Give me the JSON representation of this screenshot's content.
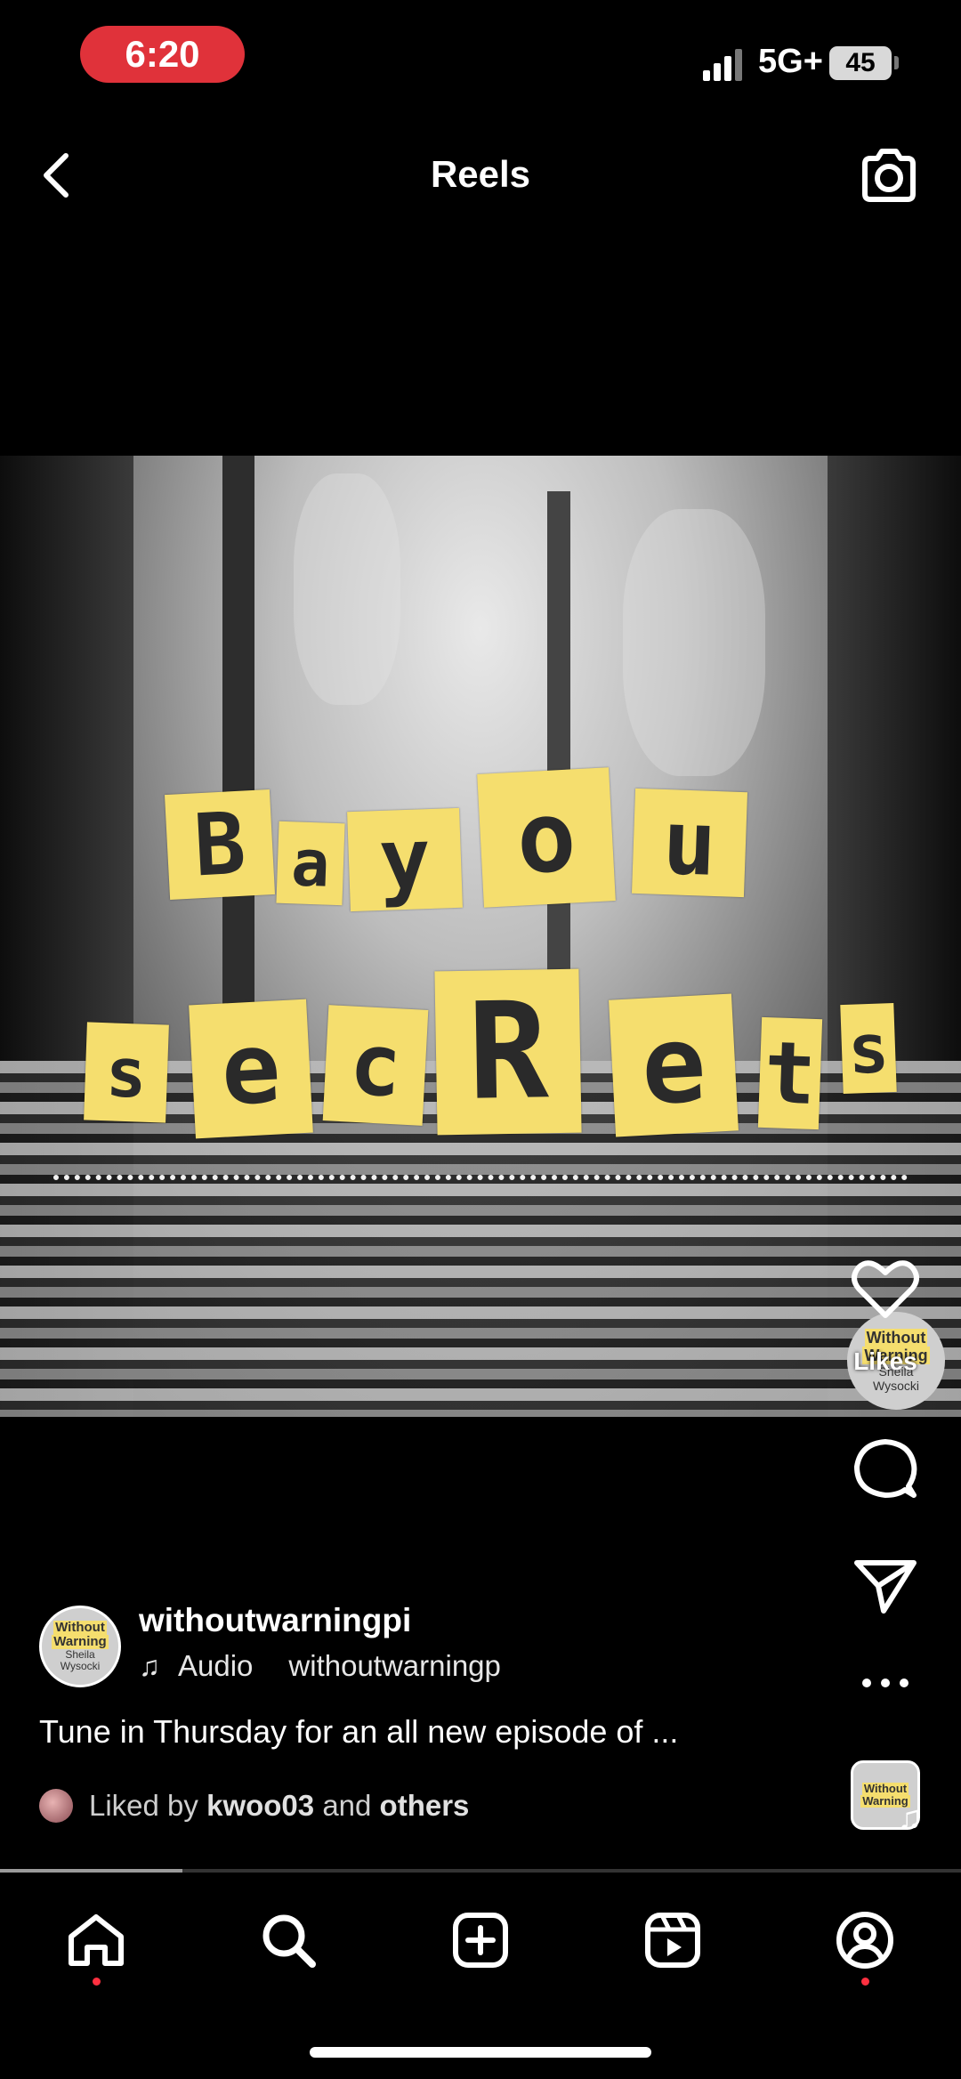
{
  "status_bar": {
    "time": "6:20",
    "network": "5G+",
    "battery": "45"
  },
  "header": {
    "title": "Reels",
    "back_icon": "chevron-left-icon",
    "camera_icon": "camera-icon"
  },
  "video": {
    "title_line1": [
      "B",
      "a",
      "y",
      "o",
      "u"
    ],
    "title_line2": [
      "s",
      "e",
      "c",
      "R",
      "e",
      "t",
      "s"
    ],
    "accent_color": "#f5de6e",
    "watermark": [
      "Without",
      "Warning",
      "Sheila",
      "Wysocki"
    ]
  },
  "actions": {
    "likes_label": "Likes"
  },
  "post": {
    "username": "withoutwarningpi",
    "audio_label": "Audio",
    "audio_owner": "withoutwarningp",
    "caption": "Tune in Thursday for an all new episode of ...",
    "liked_by_prefix": "Liked by",
    "liked_by_user": "kwoo03",
    "liked_by_and": "and",
    "liked_by_others": "others"
  },
  "progress": {
    "fraction": 0.19
  },
  "nav": {
    "items": [
      "home-icon",
      "search-icon",
      "create-icon",
      "reels-icon",
      "profile-icon"
    ]
  }
}
